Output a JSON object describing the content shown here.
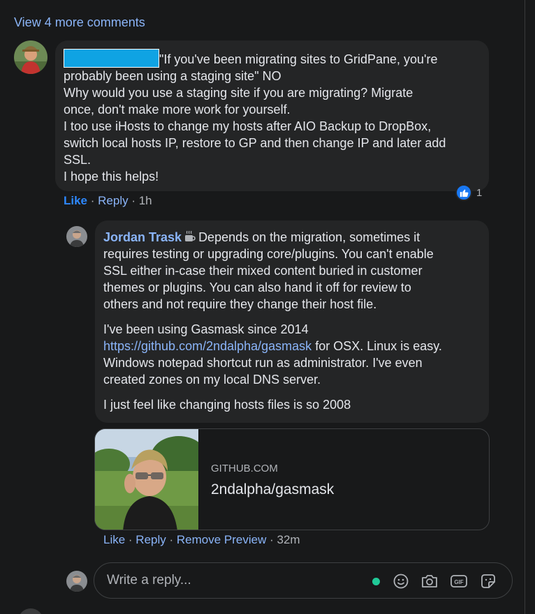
{
  "thread": {
    "view_more_label": "View 4 more comments"
  },
  "comment1": {
    "lines": [
      "\"If you've been migrating sites to GridPane, you're",
      "probably been using a staging site\" NO",
      "Why would you use a staging site if you are migrating? Migrate",
      "once, don't make more work for yourself.",
      "I too use iHosts to change my hosts after AIO Backup to DropBox,",
      "switch local hosts IP, restore to GP and then change IP and later add",
      "SSL.",
      "I hope this helps!"
    ],
    "reaction_count": "1",
    "like_label": "Like",
    "reply_label": "Reply",
    "time": "1h",
    "sep": " · "
  },
  "comment2": {
    "author": "Jordan Trask",
    "p1": [
      "Depends on the migration, sometimes it",
      "requires testing or upgrading core/plugins. You can't enable",
      "SSL either in-case their mixed content buried in customer",
      "themes or plugins. You can also hand it off for review to",
      "others and not require they change their host file."
    ],
    "p2_line1": "I've been using Gasmask since 2014",
    "p2_link": "https://github.com/2ndalpha/gasmask",
    "p2_after_link": " for OSX. Linux is easy.",
    "p2_line3": "Windows notepad shortcut run as administrator. I've even",
    "p2_line4": "created zones on my local DNS server.",
    "p3": "I just feel like changing hosts files is so 2008",
    "preview": {
      "domain": "GITHUB.COM",
      "title": "2ndalpha/gasmask"
    },
    "like_label": "Like",
    "reply_label": "Reply",
    "remove_preview_label": "Remove Preview",
    "time": "32m",
    "sep": " · "
  },
  "reply_box": {
    "placeholder": "Write a reply..."
  },
  "colors": {
    "link": "#8ab4f8",
    "like_active": "#2d88ff",
    "redaction": "#0fa3e3",
    "online": "#20c997"
  }
}
